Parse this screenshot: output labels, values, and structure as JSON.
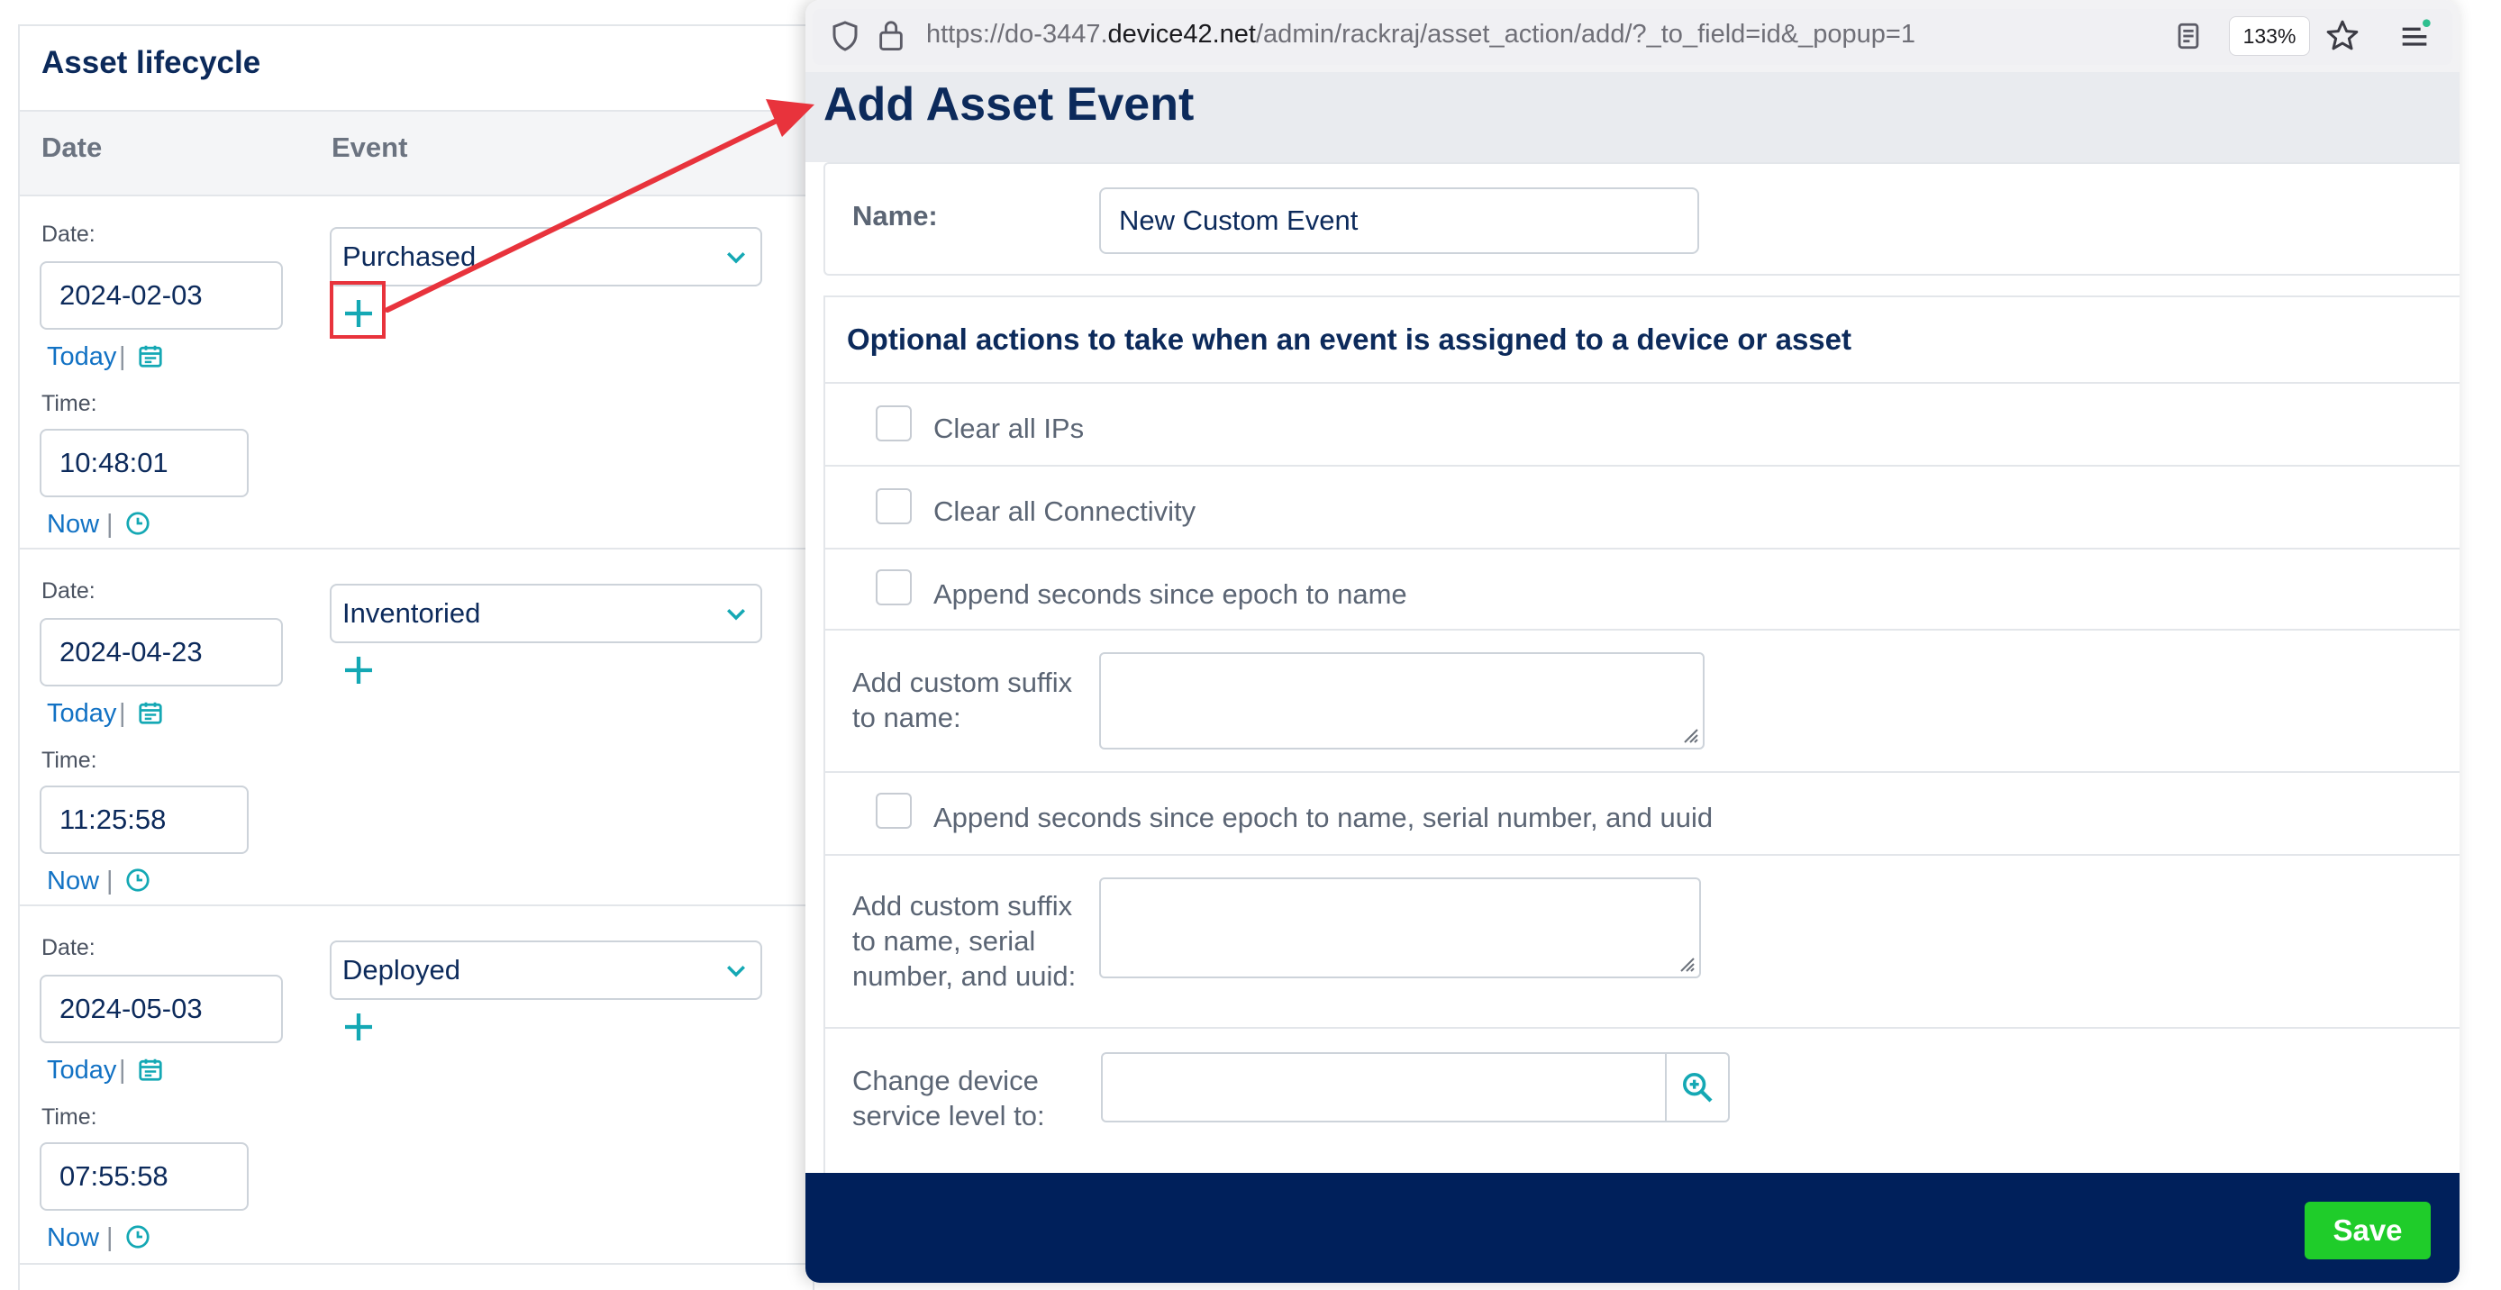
{
  "left": {
    "title": "Asset lifecycle",
    "col_date": "Date",
    "col_event": "Event",
    "rows": [
      {
        "date_label": "Date:",
        "date": "2024-02-03",
        "today": "Today",
        "time_label": "Time:",
        "time": "10:48:01",
        "now": "Now",
        "event": "Purchased"
      },
      {
        "date_label": "Date:",
        "date": "2024-04-23",
        "today": "Today",
        "time_label": "Time:",
        "time": "11:25:58",
        "now": "Now",
        "event": "Inventoried"
      },
      {
        "date_label": "Date:",
        "date": "2024-05-03",
        "today": "Today",
        "time_label": "Time:",
        "time": "07:55:58",
        "now": "Now",
        "event": "Deployed"
      }
    ],
    "pipe": "|"
  },
  "browser": {
    "url_prefix": "https://do-3447.",
    "url_host": "device42.net",
    "url_path": "/admin/rackraj/asset_action/add/?_to_field=id&_popup=1",
    "zoom": "133%"
  },
  "popup": {
    "title": "Add Asset Event",
    "name_label": "Name:",
    "name_value": "New Custom Event",
    "actions_heading": "Optional actions to take when an event is assigned to a device or asset",
    "cb_clear_ips": "Clear all IPs",
    "cb_clear_connectivity": "Clear all Connectivity",
    "cb_append_epoch_name": "Append seconds since epoch to name",
    "suffix_name_label_1": "Add custom suffix",
    "suffix_name_label_2": "to name:",
    "cb_append_epoch_all": "Append seconds since epoch to name, serial number, and uuid",
    "suffix_all_label_1": "Add custom suffix",
    "suffix_all_label_2": "to name, serial",
    "suffix_all_label_3": "number, and uuid:",
    "service_label_1": "Change device",
    "service_label_2": "service level to:",
    "save": "Save"
  },
  "colors": {
    "navy": "#0c2a5b",
    "footer": "#00205b",
    "save_green": "#1fcc2a",
    "teal_icon": "#14a8b4",
    "highlight_red": "#e8333c"
  },
  "icons": [
    "calendar-icon",
    "clock-icon",
    "plus-icon",
    "chevron-down-icon",
    "shield-icon",
    "lock-icon",
    "reader-icon",
    "star-icon",
    "menu-icon",
    "search-plus-icon"
  ]
}
